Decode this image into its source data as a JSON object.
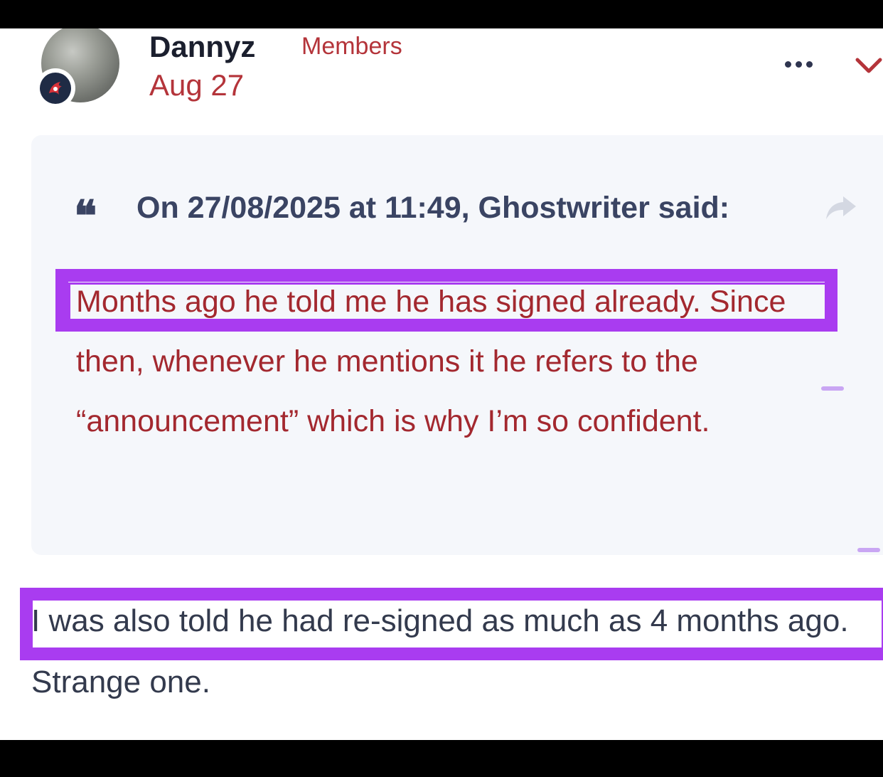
{
  "post": {
    "author": "Dannyz",
    "member_group": "Members",
    "date": "Aug 27"
  },
  "quote": {
    "header": "On 27/08/2025 at 11:49, Ghostwriter said:",
    "text": "Months ago he told me he has signed already. Since then, whenever he mentions it he refers to the “announcement” which is why I’m so confident."
  },
  "reply": {
    "text": "I was also told he had re-signed as much as 4 months ago. Strange one."
  },
  "icons": {
    "more": "ellipsis-icon",
    "chevron": "chevron-down-icon",
    "quote": "quote-icon",
    "share": "share-arrow-icon",
    "badge": "team-badge-icon"
  },
  "colors": {
    "accent": "#b4343a",
    "highlight": "#a93cf0",
    "quote_bg": "#f5f7fb",
    "heading": "#3a4463"
  }
}
